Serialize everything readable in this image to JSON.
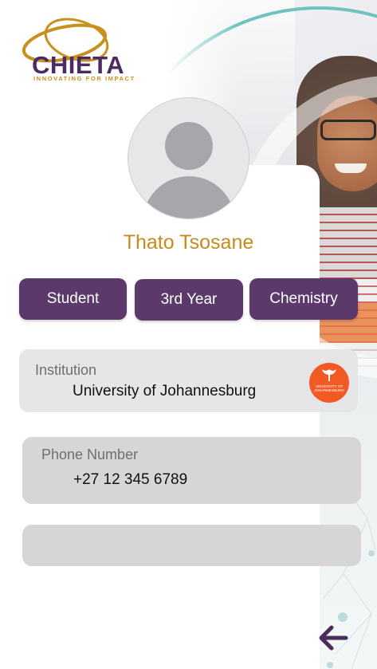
{
  "brand": {
    "name": "CHIETA",
    "tagline": "INNOVATING FOR IMPACT",
    "colors": {
      "primary": "#4c2a66",
      "accent": "#c7901f",
      "teal": "#6fc3bf"
    }
  },
  "profile": {
    "name": "Thato Tsosane",
    "avatar_icon": "user-placeholder-icon"
  },
  "chips": [
    "Student",
    "3rd Year",
    "Chemistry"
  ],
  "fields": {
    "institution": {
      "label": "Institution",
      "value": "University of Johannesburg",
      "logo_icon": "university-of-johannesburg-logo",
      "logo_text": "UNIVERSITY OF JOHANNESBURG"
    },
    "phone": {
      "label": "Phone Number",
      "value": "+27 12 345 6789"
    },
    "third": {
      "label": "",
      "value": ""
    }
  },
  "navigation": {
    "back_icon": "arrow-left-icon"
  }
}
